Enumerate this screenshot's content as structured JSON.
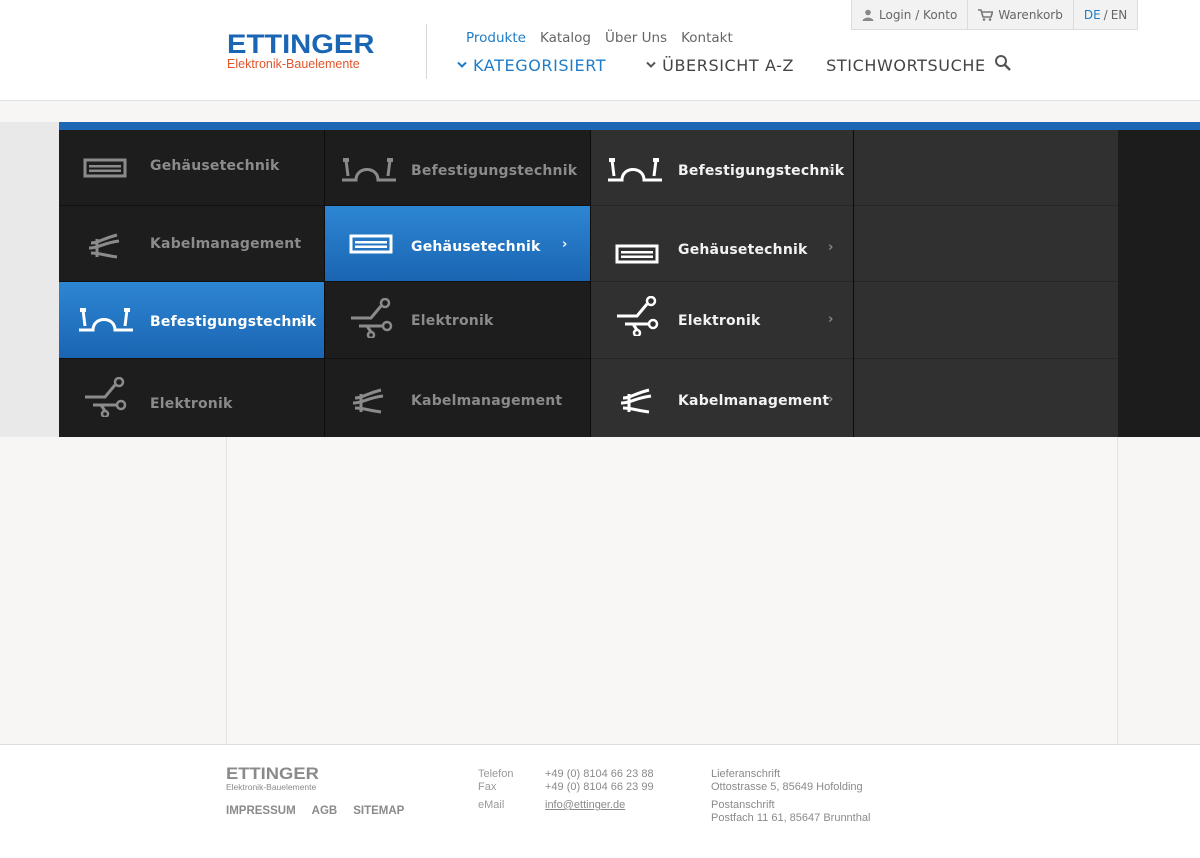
{
  "header": {
    "logo": {
      "name": "ETTINGER",
      "tagline": "Elektronik-Bauelemente"
    },
    "utility": {
      "login_label": "Login / Konto",
      "cart_label": "Warenkorb",
      "lang_de": "DE",
      "lang_sep": "/",
      "lang_en": "EN"
    },
    "topnav": [
      "Produkte",
      "Katalog",
      "Über Uns",
      "Kontakt"
    ],
    "mainnav": {
      "categorized": "KATEGORISIERT",
      "overview": "ÜBERSICHT A-Z",
      "search": "STICHWORTSUCHE"
    }
  },
  "menu": {
    "col1": [
      {
        "label": "Gehäusetechnik",
        "icon": "housing-icon"
      },
      {
        "label": "Kabelmanagement",
        "icon": "cable-icon"
      },
      {
        "label": "Befestigungstechnik",
        "icon": "fastening-icon",
        "selected": true
      },
      {
        "label": "Elektronik",
        "icon": "electronics-icon"
      }
    ],
    "col2": [
      {
        "label": "Befestigungstechnik",
        "icon": "fastening-icon"
      },
      {
        "label": "Gehäusetechnik",
        "icon": "housing-icon",
        "selected": true
      },
      {
        "label": "Elektronik",
        "icon": "electronics-icon"
      },
      {
        "label": "Kabelmanagement",
        "icon": "cable-icon"
      }
    ],
    "col3": [
      {
        "label": "Befestigungstechnik",
        "icon": "fastening-icon"
      },
      {
        "label": "Gehäusetechnik",
        "icon": "housing-icon"
      },
      {
        "label": "Elektronik",
        "icon": "electronics-icon"
      },
      {
        "label": "Kabelmanagement",
        "icon": "cable-icon"
      }
    ],
    "arrow": "›"
  },
  "colors": {
    "brand_blue": "#1a66b5",
    "brand_orange": "#e0552b",
    "selected_gradient_top": "#2d86d3",
    "selected_gradient_bottom": "#1a65b2"
  },
  "footer": {
    "logo": {
      "name": "ETTINGER",
      "tagline": "Elektronik-Bauelemente"
    },
    "links": [
      "IMPRESSUM",
      "AGB",
      "SITEMAP"
    ],
    "contact": {
      "phone_label": "Telefon",
      "phone": "+49 (0) 8104 66 23 88",
      "fax_label": "Fax",
      "fax": "+49 (0) 8104 66 23 99",
      "email_label": "eMail",
      "email": "info@ettinger.de"
    },
    "address": {
      "delivery_label": "Lieferanschrift",
      "delivery": "Ottostrasse 5, 85649 Hofolding",
      "postal_label": "Postanschrift",
      "postal": "Postfach 11 61, 85647 Brunnthal"
    }
  }
}
